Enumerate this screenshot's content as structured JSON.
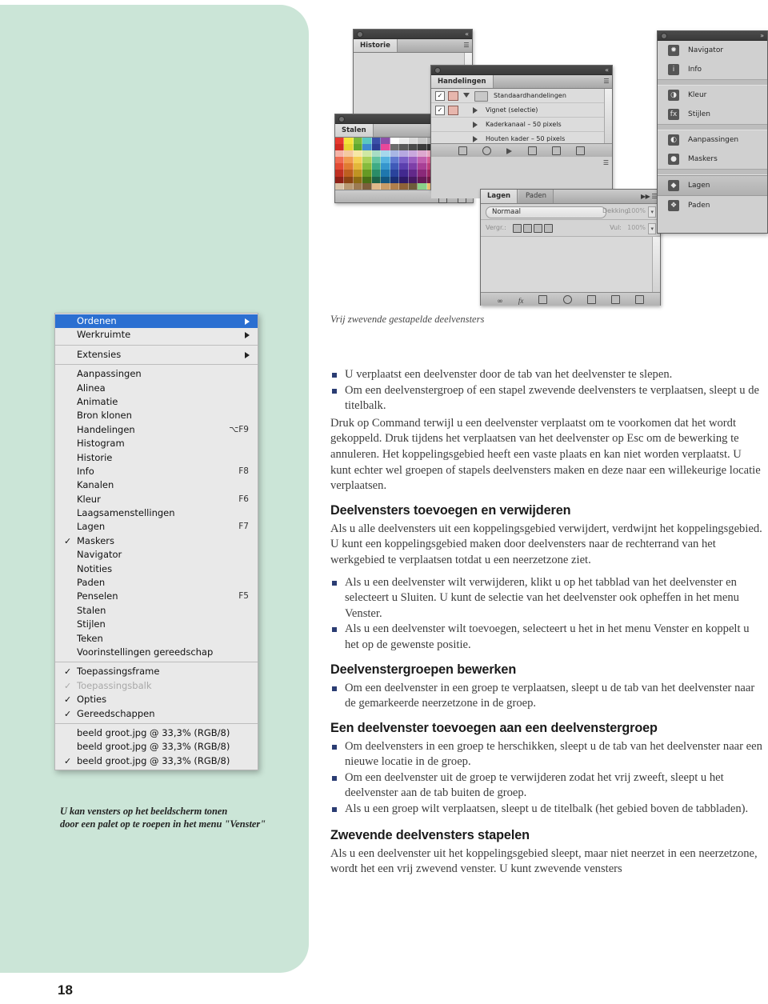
{
  "page": {
    "number": "18",
    "accent_green": "#cbe5d7",
    "bullet_color": "#2b3d73"
  },
  "menu": {
    "title": "Venster",
    "groups": [
      {
        "items": [
          {
            "label": "Ordenen",
            "shortcut": "",
            "checked": false,
            "submenu": true,
            "selected": true,
            "disabled": false
          },
          {
            "label": "Werkruimte",
            "shortcut": "",
            "checked": false,
            "submenu": true,
            "selected": false,
            "disabled": false
          }
        ]
      },
      {
        "items": [
          {
            "label": "Extensies",
            "shortcut": "",
            "checked": false,
            "submenu": true,
            "selected": false,
            "disabled": false
          }
        ]
      },
      {
        "items": [
          {
            "label": "Aanpassingen",
            "shortcut": "",
            "checked": false,
            "submenu": false,
            "selected": false,
            "disabled": false
          },
          {
            "label": "Alinea",
            "shortcut": "",
            "checked": false,
            "submenu": false,
            "selected": false,
            "disabled": false
          },
          {
            "label": "Animatie",
            "shortcut": "",
            "checked": false,
            "submenu": false,
            "selected": false,
            "disabled": false
          },
          {
            "label": "Bron klonen",
            "shortcut": "",
            "checked": false,
            "submenu": false,
            "selected": false,
            "disabled": false
          },
          {
            "label": "Handelingen",
            "shortcut": "⌥F9",
            "checked": false,
            "submenu": false,
            "selected": false,
            "disabled": false
          },
          {
            "label": "Histogram",
            "shortcut": "",
            "checked": false,
            "submenu": false,
            "selected": false,
            "disabled": false
          },
          {
            "label": "Historie",
            "shortcut": "",
            "checked": false,
            "submenu": false,
            "selected": false,
            "disabled": false
          },
          {
            "label": "Info",
            "shortcut": "F8",
            "checked": false,
            "submenu": false,
            "selected": false,
            "disabled": false
          },
          {
            "label": "Kanalen",
            "shortcut": "",
            "checked": false,
            "submenu": false,
            "selected": false,
            "disabled": false
          },
          {
            "label": "Kleur",
            "shortcut": "F6",
            "checked": false,
            "submenu": false,
            "selected": false,
            "disabled": false
          },
          {
            "label": "Laagsamenstellingen",
            "shortcut": "",
            "checked": false,
            "submenu": false,
            "selected": false,
            "disabled": false
          },
          {
            "label": "Lagen",
            "shortcut": "F7",
            "checked": false,
            "submenu": false,
            "selected": false,
            "disabled": false
          },
          {
            "label": "Maskers",
            "shortcut": "",
            "checked": true,
            "submenu": false,
            "selected": false,
            "disabled": false
          },
          {
            "label": "Navigator",
            "shortcut": "",
            "checked": false,
            "submenu": false,
            "selected": false,
            "disabled": false
          },
          {
            "label": "Notities",
            "shortcut": "",
            "checked": false,
            "submenu": false,
            "selected": false,
            "disabled": false
          },
          {
            "label": "Paden",
            "shortcut": "",
            "checked": false,
            "submenu": false,
            "selected": false,
            "disabled": false
          },
          {
            "label": "Penselen",
            "shortcut": "F5",
            "checked": false,
            "submenu": false,
            "selected": false,
            "disabled": false
          },
          {
            "label": "Stalen",
            "shortcut": "",
            "checked": false,
            "submenu": false,
            "selected": false,
            "disabled": false
          },
          {
            "label": "Stijlen",
            "shortcut": "",
            "checked": false,
            "submenu": false,
            "selected": false,
            "disabled": false
          },
          {
            "label": "Teken",
            "shortcut": "",
            "checked": false,
            "submenu": false,
            "selected": false,
            "disabled": false
          },
          {
            "label": "Voorinstellingen gereedschap",
            "shortcut": "",
            "checked": false,
            "submenu": false,
            "selected": false,
            "disabled": false
          }
        ]
      },
      {
        "items": [
          {
            "label": "Toepassingsframe",
            "shortcut": "",
            "checked": true,
            "submenu": false,
            "selected": false,
            "disabled": false
          },
          {
            "label": "Toepassingsbalk",
            "shortcut": "",
            "checked": true,
            "submenu": false,
            "selected": false,
            "disabled": true
          },
          {
            "label": "Opties",
            "shortcut": "",
            "checked": true,
            "submenu": false,
            "selected": false,
            "disabled": false
          },
          {
            "label": "Gereedschappen",
            "shortcut": "",
            "checked": true,
            "submenu": false,
            "selected": false,
            "disabled": false
          }
        ]
      },
      {
        "items": [
          {
            "label": "beeld groot.jpg @ 33,3% (RGB/8)",
            "shortcut": "",
            "checked": false,
            "submenu": false,
            "selected": false,
            "disabled": false
          },
          {
            "label": "beeld groot.jpg @ 33,3% (RGB/8)",
            "shortcut": "",
            "checked": false,
            "submenu": false,
            "selected": false,
            "disabled": false
          },
          {
            "label": "beeld groot.jpg @ 33,3% (RGB/8)",
            "shortcut": "",
            "checked": true,
            "submenu": false,
            "selected": false,
            "disabled": false
          }
        ]
      }
    ],
    "caption_line1": "U kan vensters op het beeldscherm tonen",
    "caption_line2": "door een palet op te roepen in het menu \"Venster\""
  },
  "figure": {
    "caption": "Vrij zwevende gestapelde deelvensters",
    "panels": {
      "historie_tab": "Historie",
      "handelingen_tab": "Handelingen",
      "handelingen_rows": [
        "Standaardhandelingen",
        "Vignet (selectie)",
        "Kaderkanaal – 50 pixels",
        "Houten kader – 50 pixels"
      ],
      "stalen_tab": "Stalen",
      "lagen_tab": "Lagen",
      "paden_tab": "Paden",
      "blend_mode": "Normaal",
      "dekking_label": "Dekking:",
      "dekking_value": "100%",
      "vergr_label": "Vergr.:",
      "vul_label": "Vul:",
      "vul_value": "100%"
    },
    "dock_items": [
      "Navigator",
      "Info",
      "Kleur",
      "Stijlen",
      "Aanpassingen",
      "Maskers",
      "Lagen",
      "Paden"
    ]
  },
  "body": {
    "bullets_1": [
      "U verplaatst een deelvenster door de tab van het deelvenster te slepen.",
      "Om een deelvenstergroep of een stapel zwevende deelvensters te verplaatsen, sleept u de titelbalk."
    ],
    "para_1": "Druk op Command terwijl u een deelvenster verplaatst om te voorkomen dat het wordt gekoppeld. Druk tijdens het verplaatsen van het deelvenster op Esc om de bewerking te annuleren. Het koppelingsgebied heeft een vaste plaats en kan niet worden verplaatst. U kunt echter wel groepen of stapels deelvensters maken en deze naar een willekeurige locatie verplaatsen.",
    "heading_1": "Deelvensters toevoegen en verwijderen",
    "para_2": "Als u alle deelvensters uit een koppelingsgebied verwijdert, verdwijnt het koppelingsgebied. U kunt een koppelingsgebied maken door deelvensters naar de rechterrand van het werkgebied te verplaatsen totdat u een neerzetzone ziet.",
    "bullets_2": [
      "Als u een deelvenster wilt verwijderen, klikt u op het tabblad van het deelvenster en selecteert u Sluiten. U kunt de selectie van het deelvenster ook opheffen in het menu Venster.",
      "Als u een deelvenster wilt toevoegen, selecteert u het in het menu Venster en koppelt u het op de gewenste positie."
    ],
    "heading_2": "Deelvenstergroepen bewerken",
    "bullets_3": [
      "Om een deelvenster in een groep te verplaatsen, sleept u de tab van het deelvenster naar de gemarkeerde neerzetzone in de groep."
    ],
    "heading_3": "Een deelvenster toevoegen aan een deelvenstergroep",
    "bullets_4": [
      "Om deelvensters in een groep te herschikken, sleept u de tab van het deelvenster naar een nieuwe locatie in de groep.",
      "Om een deelvenster uit de groep te verwijderen zodat het vrij zweeft, sleept u het deelvenster aan de tab buiten de groep.",
      "Als u een groep wilt verplaatsen, sleept u de titelbalk (het gebied boven de tabbladen)."
    ],
    "heading_4": "Zwevende deelvensters stapelen",
    "para_3": "Als u een deelvenster uit het koppelingsgebied sleept, maar niet neerzet in een neerzetzone, wordt het een vrij zwevend venster. U kunt zwevende vensters"
  }
}
